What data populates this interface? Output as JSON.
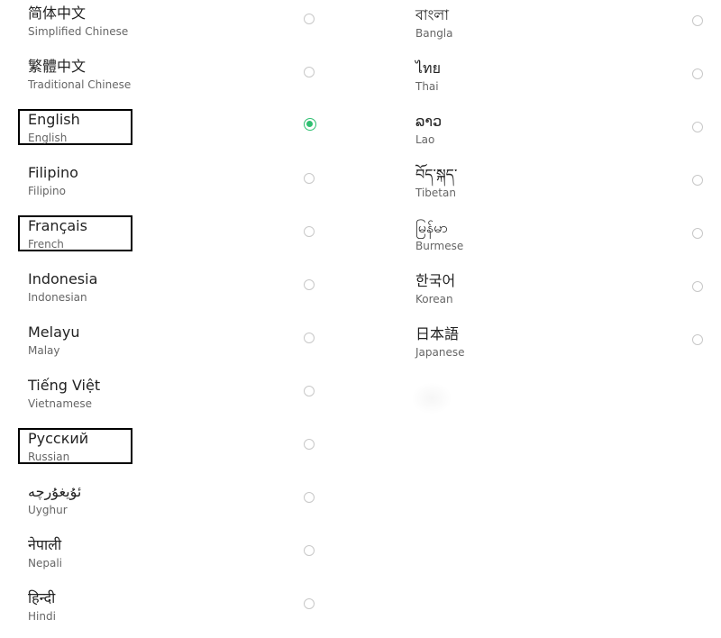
{
  "languages_left": [
    {
      "native": "简体中文",
      "english": "Simplified Chinese",
      "selected": false,
      "highlighted": false
    },
    {
      "native": "繁體中文",
      "english": "Traditional Chinese",
      "selected": false,
      "highlighted": false
    },
    {
      "native": "English",
      "english": "English",
      "selected": true,
      "highlighted": true
    },
    {
      "native": "Filipino",
      "english": "Filipino",
      "selected": false,
      "highlighted": false
    },
    {
      "native": "Français",
      "english": "French",
      "selected": false,
      "highlighted": true
    },
    {
      "native": "Indonesia",
      "english": "Indonesian",
      "selected": false,
      "highlighted": false
    },
    {
      "native": "Melayu",
      "english": "Malay",
      "selected": false,
      "highlighted": false
    },
    {
      "native": "Tiếng Việt",
      "english": "Vietnamese",
      "selected": false,
      "highlighted": false
    },
    {
      "native": "Русский",
      "english": "Russian",
      "selected": false,
      "highlighted": true
    },
    {
      "native": "ئۇيغۇرچە",
      "english": "Uyghur",
      "selected": false,
      "highlighted": false
    },
    {
      "native": "नेपाली",
      "english": "Nepali",
      "selected": false,
      "highlighted": false
    },
    {
      "native": "हिन्दी",
      "english": "Hindi",
      "selected": false,
      "highlighted": false
    }
  ],
  "languages_right": [
    {
      "native": "বাংলা",
      "english": "Bangla",
      "selected": false
    },
    {
      "native": "ไทย",
      "english": "Thai",
      "selected": false
    },
    {
      "native": "ລາວ",
      "english": "Lao",
      "selected": false
    },
    {
      "native": "བོད་སྐད་",
      "english": "Tibetan",
      "selected": false
    },
    {
      "native": "မြန်မာ",
      "english": "Burmese",
      "selected": false
    },
    {
      "native": "한국어",
      "english": "Korean",
      "selected": false
    },
    {
      "native": "日本語",
      "english": "Japanese",
      "selected": false
    }
  ],
  "colors": {
    "accent_selected": "#2fbf71",
    "radio_border": "#c8c8c8",
    "primary_text": "#222222",
    "secondary_text": "#666666",
    "highlight_box": "#000000"
  },
  "icons": {
    "radio_unchecked": "radio-unchecked-icon",
    "radio_checked": "radio-checked-icon"
  }
}
